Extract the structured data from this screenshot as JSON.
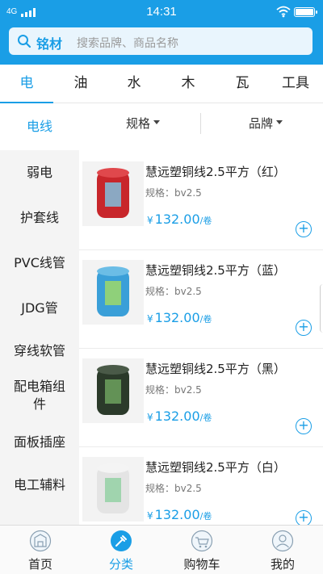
{
  "status_bar": {
    "network": "4G",
    "time": "14:31"
  },
  "search": {
    "category": "铭材",
    "placeholder": "搜索品牌、商品名称"
  },
  "tabs": [
    {
      "label": "电",
      "active": true
    },
    {
      "label": "油"
    },
    {
      "label": "水"
    },
    {
      "label": "木"
    },
    {
      "label": "瓦"
    },
    {
      "label": "工具"
    }
  ],
  "sidebar": {
    "items": [
      {
        "label": "电线",
        "active": true
      },
      {
        "label": "弱电"
      },
      {
        "label": "护套线"
      },
      {
        "label": "PVC线管"
      },
      {
        "label": "JDG管"
      },
      {
        "label": "穿线软管"
      },
      {
        "label": "配电箱组件"
      },
      {
        "label": "面板插座"
      },
      {
        "label": "电工辅料"
      }
    ]
  },
  "filters": {
    "spec": "规格",
    "brand": "品牌"
  },
  "products": [
    {
      "name": "慧远塑铜线2.5平方（红）",
      "spec": "规格：bv2.5",
      "currency": "¥",
      "price": "132.00",
      "unit": "/卷",
      "color": "#c8262b"
    },
    {
      "name": "慧远塑铜线2.5平方（蓝）",
      "spec": "规格：bv2.5",
      "currency": "¥",
      "price": "132.00",
      "unit": "/卷",
      "color": "#3a9fd8"
    },
    {
      "name": "慧远塑铜线2.5平方（黑）",
      "spec": "规格：bv2.5",
      "currency": "¥",
      "price": "132.00",
      "unit": "/卷",
      "color": "#2b3a2a"
    },
    {
      "name": "慧远塑铜线2.5平方（白）",
      "spec": "规格：bv2.5",
      "currency": "¥",
      "price": "132.00",
      "unit": "/卷",
      "color": "#e4e4e4"
    }
  ],
  "bottom_nav": [
    {
      "label": "首页",
      "icon": "home-icon"
    },
    {
      "label": "分类",
      "icon": "category-icon",
      "active": true
    },
    {
      "label": "购物车",
      "icon": "cart-icon"
    },
    {
      "label": "我的",
      "icon": "profile-icon"
    }
  ],
  "colors": {
    "accent": "#1a9ee6",
    "sidebar_bg": "#f4f4f4"
  }
}
